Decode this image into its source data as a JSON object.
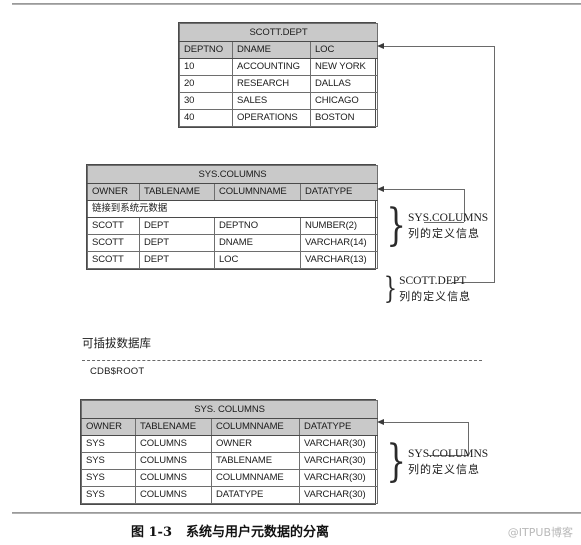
{
  "figure": {
    "caption_number": "图 1-3",
    "caption_text": "系统与用户元数据的分离",
    "watermark": "@ITPUB博客"
  },
  "tables": {
    "scott_dept": {
      "title": "SCOTT.DEPT",
      "columns": [
        "DEPTNO",
        "DNAME",
        "LOC"
      ],
      "rows": [
        [
          "10",
          "ACCOUNTING",
          "NEW YORK"
        ],
        [
          "20",
          "RESEARCH",
          "DALLAS"
        ],
        [
          "30",
          "SALES",
          "CHICAGO"
        ],
        [
          "40",
          "OPERATIONS",
          "BOSTON"
        ]
      ]
    },
    "sys_columns_mid": {
      "title": "SYS.COLUMNS",
      "columns": [
        "OWNER",
        "TABLENAME",
        "COLUMNNAME",
        "DATATYPE"
      ],
      "merged_note": "链接到系统元数据",
      "rows": [
        [
          "SCOTT",
          "DEPT",
          "DEPTNO",
          "NUMBER(2)"
        ],
        [
          "SCOTT",
          "DEPT",
          "DNAME",
          "VARCHAR(14)"
        ],
        [
          "SCOTT",
          "DEPT",
          "LOC",
          "VARCHAR(13)"
        ]
      ]
    },
    "sys_columns_bottom": {
      "title": "SYS. COLUMNS",
      "columns": [
        "OWNER",
        "TABLENAME",
        "COLUMNNAME",
        "DATATYPE"
      ],
      "rows": [
        [
          "SYS",
          "COLUMNS",
          "OWNER",
          "VARCHAR(30)"
        ],
        [
          "SYS",
          "COLUMNS",
          "TABLENAME",
          "VARCHAR(30)"
        ],
        [
          "SYS",
          "COLUMNS",
          "COLUMNNAME",
          "VARCHAR(30)"
        ],
        [
          "SYS",
          "COLUMNS",
          "DATATYPE",
          "VARCHAR(30)"
        ]
      ]
    }
  },
  "annotations": {
    "mid_upper": {
      "line1": "SYS.COLUMNS",
      "line2": "列的定义信息"
    },
    "mid_lower": {
      "line1": "SCOTT.DEPT",
      "line2": "列的定义信息"
    },
    "bottom": {
      "line1": "SYS.COLUMNS",
      "line2": "列的定义信息"
    }
  },
  "pluggable_section": {
    "label": "可插拔数据库",
    "root_label": "CDB$ROOT"
  },
  "colors": {
    "header_fill": "#c9c9c9",
    "border": "#4a4a4a",
    "connector": "#6a6a6a",
    "watermark": "#b9b9b9"
  }
}
